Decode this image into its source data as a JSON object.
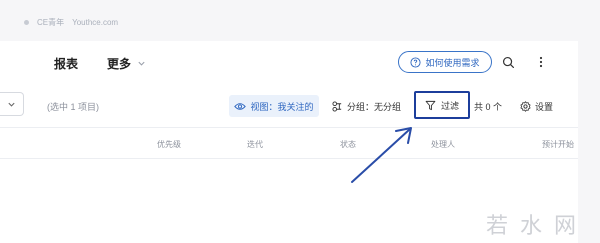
{
  "source": {
    "brand": "CE青年",
    "site": "Youthce.com"
  },
  "nav": {
    "tab_reports": "报表",
    "tab_more": "更多",
    "help_button": "如何使用需求",
    "icons": {
      "search": "search-icon",
      "menu": "more-vertical-icon",
      "help": "question-circle-icon"
    }
  },
  "toolbar": {
    "selected_count": "(选中 1 项目)",
    "view_label": "视图：我关注的",
    "group_label": "分组：无分组",
    "filter_label": "过滤",
    "total_label": "共 0 个",
    "settings_label": "设置"
  },
  "table": {
    "columns": [
      "优先级",
      "迭代",
      "状态",
      "处理人",
      "预计开始"
    ]
  },
  "watermark": "若水网",
  "colors": {
    "accent": "#2f67c0",
    "highlight_box": "#1c3e9b",
    "arrow": "#2a4da8",
    "view_chip_bg": "#eaf1fb"
  }
}
